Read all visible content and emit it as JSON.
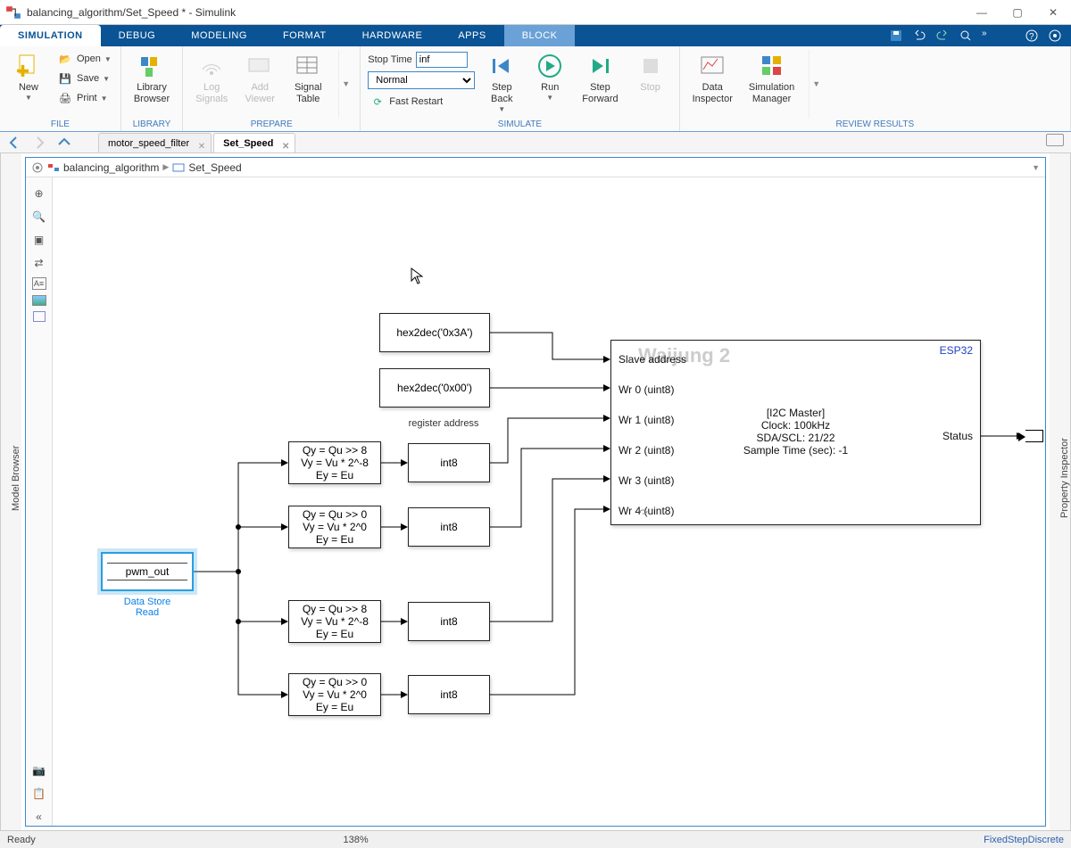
{
  "titlebar": {
    "title": "balancing_algorithm/Set_Speed * - Simulink"
  },
  "ribbon_tabs": {
    "simulation": "SIMULATION",
    "debug": "DEBUG",
    "modeling": "MODELING",
    "format": "FORMAT",
    "hardware": "HARDWARE",
    "apps": "APPS",
    "block": "BLOCK"
  },
  "ribbon": {
    "file": {
      "new": "New",
      "open": "Open",
      "save": "Save",
      "print": "Print",
      "label": "FILE"
    },
    "library": {
      "btn": "Library\nBrowser",
      "label": "LIBRARY"
    },
    "prepare": {
      "log_signals": "Log\nSignals",
      "add_viewer": "Add\nViewer",
      "signal_table": "Signal\nTable",
      "label": "PREPARE"
    },
    "simulate": {
      "stop_time_label": "Stop Time",
      "stop_time_value": "inf",
      "mode": "Normal",
      "fast_restart": "Fast Restart",
      "step_back": "Step\nBack",
      "run": "Run",
      "step_forward": "Step\nForward",
      "stop": "Stop",
      "label": "SIMULATE"
    },
    "review": {
      "data_inspector": "Data\nInspector",
      "sim_manager": "Simulation\nManager",
      "label": "REVIEW RESULTS"
    }
  },
  "file_tabs": {
    "tab1": "motor_speed_filter",
    "tab2": "Set_Speed"
  },
  "breadcrumb": {
    "root": "balancing_algorithm",
    "leaf": "Set_Speed"
  },
  "side_left": "Model Browser",
  "side_right": "Property Inspector",
  "canvas": {
    "const1": "hex2dec('0x3A')",
    "const1_label_top": "Slave Address",
    "const2": "hex2dec('0x00')",
    "const2_label": "register address",
    "extract": {
      "l1": "Qy = Qu >> 8",
      "l2": "Vy = Vu * 2^-8",
      "l3": "Ey = Eu"
    },
    "extract_lo": {
      "l1": "Qy = Qu >> 0",
      "l2": "Vy = Vu * 2^0",
      "l3": "Ey = Eu"
    },
    "int8": "int8",
    "dsr_name": "pwm_out",
    "dsr_label": "Data Store\nRead",
    "i2c": {
      "watermark": "Waijung 2",
      "esp": "ESP32",
      "p0": "Slave address",
      "p1": "Wr 0 (uint8)",
      "p2": "Wr 1 (uint8)",
      "p3": "Wr 2 (uint8)",
      "p4": "Wr 3 (uint8)",
      "p5": "Wr 4 (uint8)",
      "out": "Status",
      "cfg1": "[I2C Master]",
      "cfg2": "Clock: 100kHz",
      "cfg3": "SDA/SCL: 21/22",
      "cfg4": "Sample Time (sec): -1"
    }
  },
  "status": {
    "ready": "Ready",
    "zoom": "138%",
    "solver": "FixedStepDiscrete"
  },
  "chart_data": {
    "type": "block-diagram",
    "description": "Simulink subsystem Set_Speed: reads pwm_out from Data Store, splits each motor channel into high/low bytes (>>8 and >>0), casts to int8, and writes 5 bytes (slave addr register 0x00 plus 4 data bytes) to I2C Master block (ESP32 Waijung2, 100kHz, SDA21/SCL22). Two constants supply slave address 0x3A and register 0x00.",
    "nodes": [
      {
        "id": "pwm_out",
        "type": "DataStoreRead",
        "label": "pwm_out"
      },
      {
        "id": "c3A",
        "type": "Constant",
        "label": "hex2dec('0x3A')"
      },
      {
        "id": "c00",
        "type": "Constant",
        "label": "hex2dec('0x00')"
      },
      {
        "id": "ext1",
        "type": "ExtractBits",
        "shift": 8
      },
      {
        "id": "ext2",
        "type": "ExtractBits",
        "shift": 0
      },
      {
        "id": "ext3",
        "type": "ExtractBits",
        "shift": 8
      },
      {
        "id": "ext4",
        "type": "ExtractBits",
        "shift": 0
      },
      {
        "id": "cast1",
        "type": "DataTypeConversion",
        "dtype": "int8"
      },
      {
        "id": "cast2",
        "type": "DataTypeConversion",
        "dtype": "int8"
      },
      {
        "id": "cast3",
        "type": "DataTypeConversion",
        "dtype": "int8"
      },
      {
        "id": "cast4",
        "type": "DataTypeConversion",
        "dtype": "int8"
      },
      {
        "id": "i2c",
        "type": "Waijung2_I2CMaster",
        "clock": "100kHz",
        "sda_scl": "21/22",
        "sample_time": -1,
        "target": "ESP32"
      },
      {
        "id": "term",
        "type": "Terminator"
      }
    ],
    "edges": [
      [
        "pwm_out",
        "ext1"
      ],
      [
        "pwm_out",
        "ext2"
      ],
      [
        "pwm_out",
        "ext3"
      ],
      [
        "pwm_out",
        "ext4"
      ],
      [
        "ext1",
        "cast1"
      ],
      [
        "ext2",
        "cast2"
      ],
      [
        "ext3",
        "cast3"
      ],
      [
        "ext4",
        "cast4"
      ],
      [
        "c3A",
        "i2c.SlaveAddress"
      ],
      [
        "c00",
        "i2c.Wr0"
      ],
      [
        "cast1",
        "i2c.Wr1"
      ],
      [
        "cast2",
        "i2c.Wr2"
      ],
      [
        "cast3",
        "i2c.Wr3"
      ],
      [
        "cast4",
        "i2c.Wr4"
      ],
      [
        "i2c.Status",
        "term"
      ]
    ]
  }
}
